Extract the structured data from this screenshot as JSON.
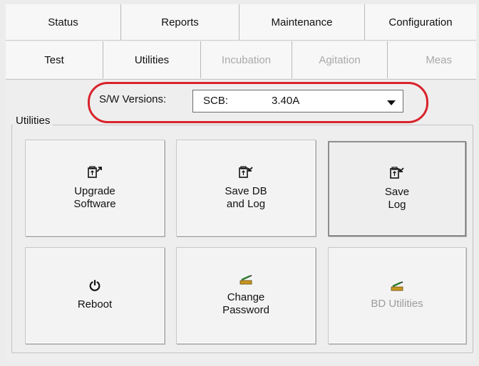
{
  "tabs_top": [
    {
      "label": "Status"
    },
    {
      "label": "Reports"
    },
    {
      "label": "Maintenance"
    },
    {
      "label": "Configuration"
    }
  ],
  "tabs_sub": [
    {
      "label": "Test",
      "state": "enabled"
    },
    {
      "label": "Utilities",
      "state": "active"
    },
    {
      "label": "Incubation",
      "state": "disabled"
    },
    {
      "label": "Agitation",
      "state": "disabled"
    },
    {
      "label": "Meas",
      "state": "disabled"
    }
  ],
  "versions": {
    "label": "S/W Versions:",
    "selected_key": "SCB:",
    "selected_value": "3.40A"
  },
  "utilities": {
    "group_label": "Utilities",
    "buttons": [
      {
        "label": "Upgrade\nSoftware",
        "icon": "usb-upload-icon",
        "state": "enabled"
      },
      {
        "label": "Save DB\nand Log",
        "icon": "usb-save-icon",
        "state": "enabled"
      },
      {
        "label": "Save\nLog",
        "icon": "usb-save-icon",
        "state": "selected"
      },
      {
        "label": "Reboot",
        "icon": "power-icon",
        "state": "enabled"
      },
      {
        "label": "Change\nPassword",
        "icon": "key-pencil-icon",
        "state": "enabled"
      },
      {
        "label": "BD Utilities",
        "icon": "key-pencil-icon",
        "state": "disabled"
      }
    ]
  },
  "colors": {
    "highlight": "#d9222a",
    "disabled_text": "#a9a9a9"
  }
}
